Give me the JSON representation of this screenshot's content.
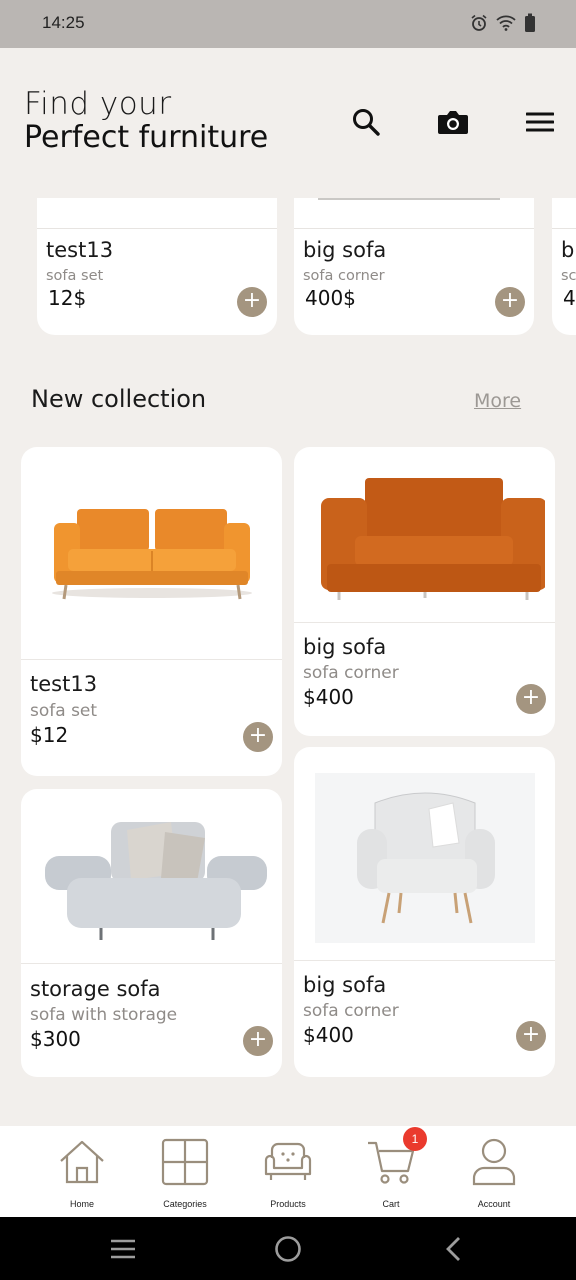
{
  "status_bar": {
    "time": "14:25"
  },
  "header": {
    "title_line1": "Find your",
    "title_line2": "Perfect furniture"
  },
  "top_products": [
    {
      "name": "test13",
      "category": "sofa set",
      "price": "12$"
    },
    {
      "name": "big sofa",
      "category": "sofa corner",
      "price": "400$"
    },
    {
      "name": "b",
      "category": "sc",
      "price": "4"
    }
  ],
  "new_collection": {
    "title": "New collection",
    "more_label": "More",
    "items": [
      {
        "name": "test13",
        "category": "sofa set",
        "price": "$12"
      },
      {
        "name": "big sofa",
        "category": "sofa corner",
        "price": "$400"
      },
      {
        "name": "storage sofa",
        "category": "sofa with storage",
        "price": "$300"
      },
      {
        "name": "big sofa",
        "category": "sofa corner",
        "price": "$400"
      }
    ]
  },
  "add_symbol": "+",
  "bottom_nav": {
    "items": [
      {
        "label": "Home",
        "icon": "home-icon"
      },
      {
        "label": "Categories",
        "icon": "grid-icon"
      },
      {
        "label": "Products",
        "icon": "sofa-icon"
      },
      {
        "label": "Cart",
        "icon": "cart-icon",
        "badge": "1"
      },
      {
        "label": "Account",
        "icon": "user-icon"
      }
    ]
  },
  "colors": {
    "accent": "#a49580",
    "background": "#f2efec",
    "badge": "#ea3a2d"
  }
}
